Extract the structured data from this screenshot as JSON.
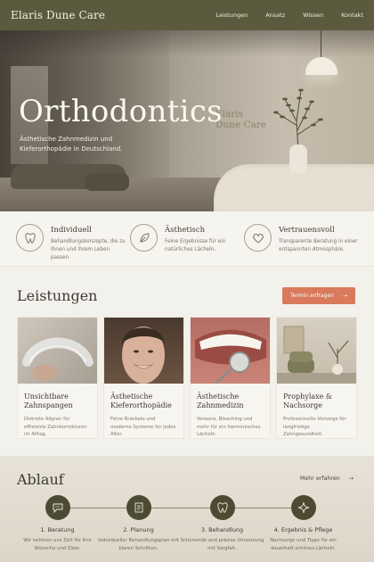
{
  "nav": {
    "brand": "Elaris Dune Care",
    "links": [
      "Leistungen",
      "Ansatz",
      "Wissen",
      "Kontakt"
    ]
  },
  "hero": {
    "title": "Orthodontics",
    "subtitle": "Ästhetische Zahnmedizin und Kieferorthopädie in Deutschland.",
    "signage_line1": "Elaris",
    "signage_line2": "Dune Care"
  },
  "features": [
    {
      "title": "Individuell",
      "desc": "Behandlungskonzepte, die zu Ihnen und Ihrem Leben passen.",
      "icon": "tooth-icon"
    },
    {
      "title": "Ästhetisch",
      "desc": "Feine Ergebnisse für ein natürliches Lächeln.",
      "icon": "leaf-icon"
    },
    {
      "title": "Vertrauensvoll",
      "desc": "Transparente Beratung in einer entspannten Atmosphäre.",
      "icon": "heart-icon"
    }
  ],
  "services": {
    "heading": "Leistungen",
    "cta_label": "Termin anfragen",
    "cta_color": "#d87a5b",
    "cards": [
      {
        "title": "Unsichtbare Zahnspangen",
        "desc": "Diskrete Aligner für effiziente Zahnkorrekturen im Alltag."
      },
      {
        "title": "Ästhetische Kieferorthopädie",
        "desc": "Feine Brackets und moderne Systeme für jedes Alter."
      },
      {
        "title": "Ästhetische Zahnmedizin",
        "desc": "Veneers, Bleaching und mehr für ein harmonisches Lächeln."
      },
      {
        "title": "Prophylaxe & Nachsorge",
        "desc": "Professionelle Vorsorge für langfristige Zahngesundheit."
      }
    ]
  },
  "process": {
    "heading": "Ablauf",
    "more_label": "Mehr erfahren",
    "steps": [
      {
        "title": "1. Beratung",
        "desc": "Wir nehmen uns Zeit für Ihre Wünsche und Ziele.",
        "icon": "chat-icon"
      },
      {
        "title": "2. Planung",
        "desc": "Individueller Behandlungsplan mit klaren Schritten.",
        "icon": "clipboard-icon"
      },
      {
        "title": "3. Behandlung",
        "desc": "Schonende und präzise Umsetzung mit Sorgfalt.",
        "icon": "tooth-icon"
      },
      {
        "title": "4. Ergebnis & Pflege",
        "desc": "Nachsorge und Tipps für ein dauerhaft schönes Lächeln.",
        "icon": "sparkle-icon"
      }
    ]
  },
  "colors": {
    "nav_bg": "#5c5a3e",
    "accent": "#d87a5b",
    "step_circle": "#4c4a33"
  }
}
